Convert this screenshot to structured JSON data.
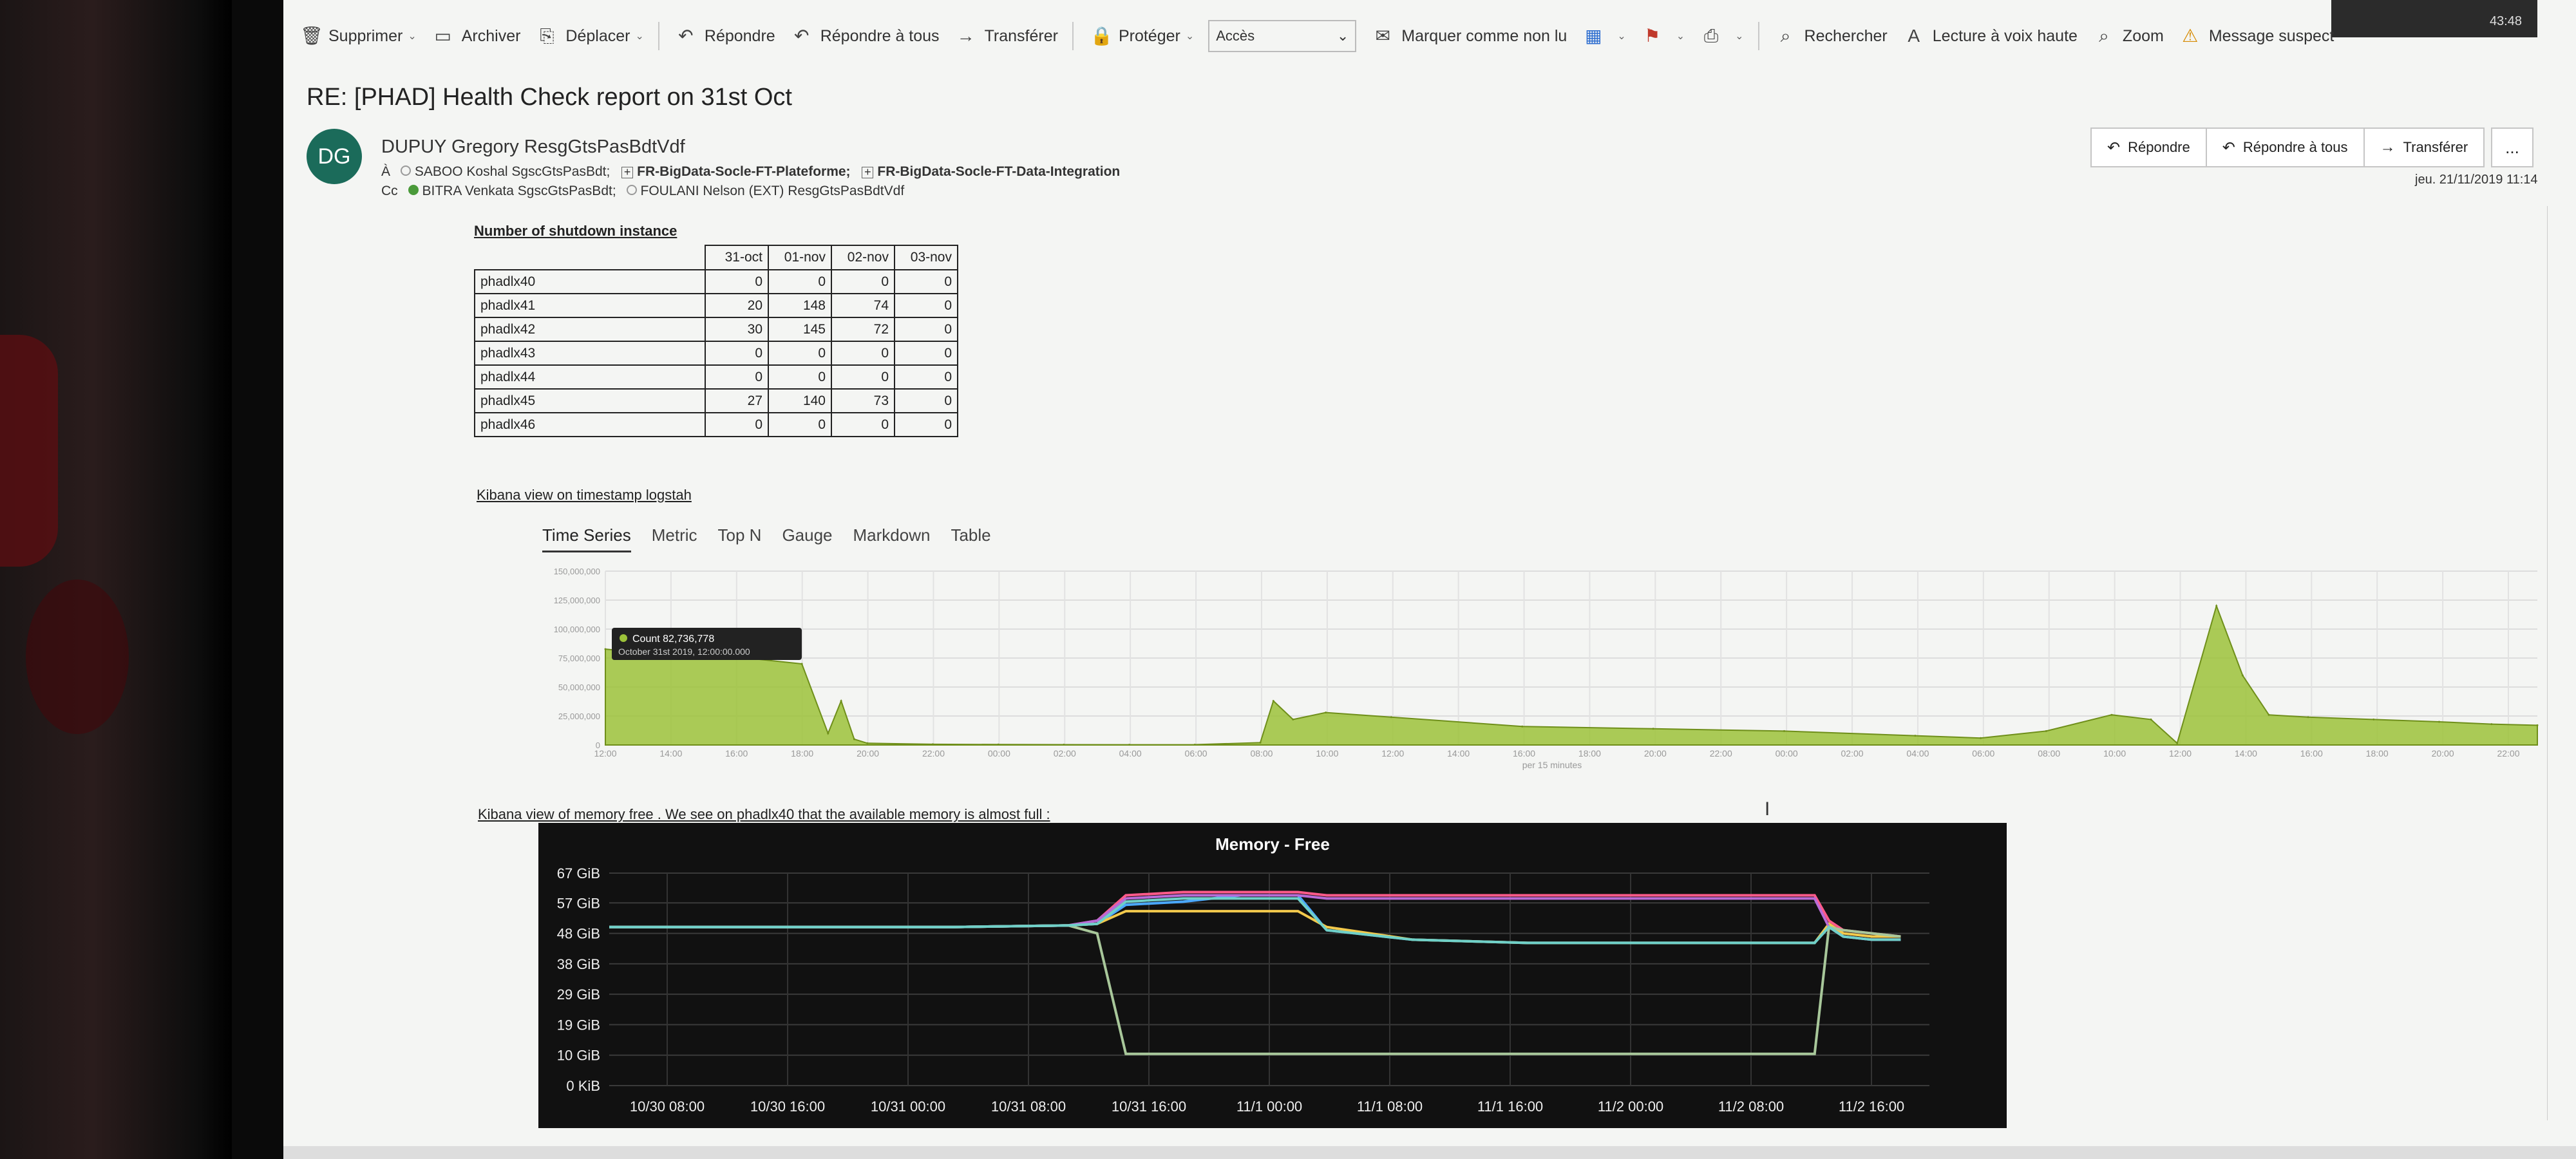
{
  "notification": {
    "time": "43:48"
  },
  "toolbar": {
    "delete": "Supprimer",
    "archive": "Archiver",
    "move": "Déplacer",
    "reply": "Répondre",
    "reply_all": "Répondre à tous",
    "forward": "Transférer",
    "protect": "Protéger",
    "access": "Accès",
    "mark_unread": "Marquer comme non lu",
    "search": "Rechercher",
    "read_aloud": "Lecture à voix haute",
    "zoom": "Zoom",
    "suspicious": "Message suspect"
  },
  "email": {
    "subject": "RE: [PHAD] Health Check report on 31st Oct",
    "avatar_initials": "DG",
    "sender": "DUPUY Gregory ResgGtsPasBdtVdf",
    "to_label": "À",
    "to": [
      "SABOO Koshal SgscGtsPasBdt;",
      "FR-BigData-Socle-FT-Plateforme;",
      "FR-BigData-Socle-FT-Data-Integration"
    ],
    "cc_label": "Cc",
    "cc": [
      "BITRA Venkata SgscGtsPasBdt;",
      "FOULANI Nelson (EXT) ResgGtsPasBdtVdf"
    ],
    "date": "jeu. 21/11/2019 11:14",
    "actions": {
      "reply": "Répondre",
      "reply_all": "Répondre à tous",
      "forward": "Transférer",
      "more": "..."
    }
  },
  "shutdown": {
    "heading": "Number of shutdown instance",
    "columns": [
      "31-oct",
      "01-nov",
      "02-nov",
      "03-nov"
    ],
    "rows": [
      {
        "name": "phadlx40",
        "values": [
          "0",
          "0",
          "0",
          "0"
        ]
      },
      {
        "name": "phadlx41",
        "values": [
          "20",
          "148",
          "74",
          "0"
        ]
      },
      {
        "name": "phadlx42",
        "values": [
          "30",
          "145",
          "72",
          "0"
        ]
      },
      {
        "name": "phadlx43",
        "values": [
          "0",
          "0",
          "0",
          "0"
        ]
      },
      {
        "name": "phadlx44",
        "values": [
          "0",
          "0",
          "0",
          "0"
        ]
      },
      {
        "name": "phadlx45",
        "values": [
          "27",
          "140",
          "73",
          "0"
        ]
      },
      {
        "name": "phadlx46",
        "values": [
          "0",
          "0",
          "0",
          "0"
        ]
      }
    ]
  },
  "kibana": {
    "heading": "Kibana view on timestamp logstah",
    "tabs": [
      "Time Series",
      "Metric",
      "Top N",
      "Gauge",
      "Markdown",
      "Table"
    ],
    "tooltip_count": "Count  82,736,778",
    "tooltip_date": "October 31st 2019, 12:00:00.000"
  },
  "memory": {
    "heading": "Kibana view of memory free . We see on phadlx40 that the available memory is almost full :"
  },
  "chart_data": [
    {
      "type": "area",
      "title": "",
      "xlabel": "per 15 minutes",
      "ylabel": "",
      "ylim": [
        0,
        150000000
      ],
      "y_ticks": [
        "0",
        "25,000,000",
        "50,000,000",
        "75,000,000",
        "100,000,000",
        "125,000,000",
        "150,000,000"
      ],
      "x_ticks": [
        "12:00",
        "14:00",
        "16:00",
        "18:00",
        "20:00",
        "22:00",
        "00:00",
        "02:00",
        "04:00",
        "06:00",
        "08:00",
        "10:00",
        "12:00",
        "14:00",
        "16:00",
        "18:00",
        "20:00",
        "22:00",
        "00:00",
        "02:00",
        "04:00",
        "06:00",
        "08:00",
        "10:00",
        "12:00",
        "14:00",
        "16:00",
        "18:00",
        "20:00",
        "22:00"
      ],
      "x": [
        0,
        0.5,
        1,
        2,
        3,
        3.4,
        3.6,
        3.8,
        4,
        5,
        6,
        7,
        8,
        9,
        10,
        10.2,
        10.5,
        11,
        12,
        14,
        16,
        18,
        20,
        21,
        22,
        23,
        23.6,
        24,
        24.6,
        25,
        25.4,
        26,
        27,
        28,
        28.8,
        29.5
      ],
      "values": [
        82736778,
        80000000,
        78000000,
        76000000,
        70000000,
        10000000,
        38000000,
        5000000,
        1500000,
        600000,
        400000,
        300000,
        200000,
        300000,
        2000000,
        38000000,
        22000000,
        28000000,
        24000000,
        16000000,
        14000000,
        12000000,
        8000000,
        6000000,
        12000000,
        26000000,
        22000000,
        1500000,
        120000000,
        60000000,
        26000000,
        24000000,
        22000000,
        20000000,
        18000000,
        17000000
      ],
      "grid": true,
      "color": "#9cc23a"
    },
    {
      "type": "line",
      "title": "Memory - Free",
      "xlabel": "",
      "ylabel": "",
      "ylim": [
        0,
        67
      ],
      "y_ticks": [
        "0 KiB",
        "10 GiB",
        "19 GiB",
        "29 GiB",
        "38 GiB",
        "48 GiB",
        "57 GiB",
        "67 GiB"
      ],
      "y_tick_values": [
        0,
        9.6,
        19.2,
        28.8,
        38.4,
        48,
        57.6,
        67
      ],
      "x_ticks": [
        "10/30 08:00",
        "10/30 16:00",
        "10/31 00:00",
        "10/31 08:00",
        "10/31 16:00",
        "11/1 00:00",
        "11/1 08:00",
        "11/1 16:00",
        "11/2 00:00",
        "11/2 08:00",
        "11/2 16:00"
      ],
      "x": [
        0,
        8,
        16,
        24,
        32,
        34,
        36,
        40,
        44,
        48,
        50,
        56,
        64,
        72,
        80,
        84,
        85,
        86,
        88,
        90
      ],
      "series": [
        {
          "color": "#ff5a8a",
          "values": [
            50,
            50,
            50,
            50,
            50.5,
            52,
            60,
            61,
            61,
            61,
            60,
            60,
            60,
            60,
            60,
            60,
            52,
            49,
            48,
            47
          ]
        },
        {
          "color": "#4aa8ff",
          "values": [
            50,
            50,
            50,
            50,
            50.5,
            51,
            57,
            58,
            60,
            60,
            49,
            46,
            45,
            45,
            45,
            45,
            51,
            47,
            46,
            46
          ]
        },
        {
          "color": "#f2c94c",
          "values": [
            50,
            50,
            50,
            50,
            50.5,
            51,
            55,
            55,
            55,
            55,
            50,
            46,
            45,
            45,
            45,
            45,
            51,
            48,
            47,
            47
          ]
        },
        {
          "color": "#b86bd6",
          "values": [
            50,
            50,
            50,
            50,
            50.5,
            52,
            59,
            60,
            60,
            60,
            59,
            59,
            59,
            59,
            59,
            59,
            50,
            47,
            46,
            46
          ]
        },
        {
          "color": "#a8c79a",
          "values": [
            50,
            50,
            50,
            50,
            50.5,
            48,
            10,
            10,
            10,
            10,
            10,
            10,
            10,
            10,
            10,
            10,
            50,
            49,
            48,
            47
          ]
        },
        {
          "color": "#6fd0c8",
          "values": [
            50,
            50,
            50,
            50,
            50.5,
            51,
            58,
            59,
            59,
            59,
            49,
            46,
            45,
            45,
            45,
            45,
            50,
            47,
            46,
            46
          ]
        }
      ],
      "grid": true
    }
  ]
}
